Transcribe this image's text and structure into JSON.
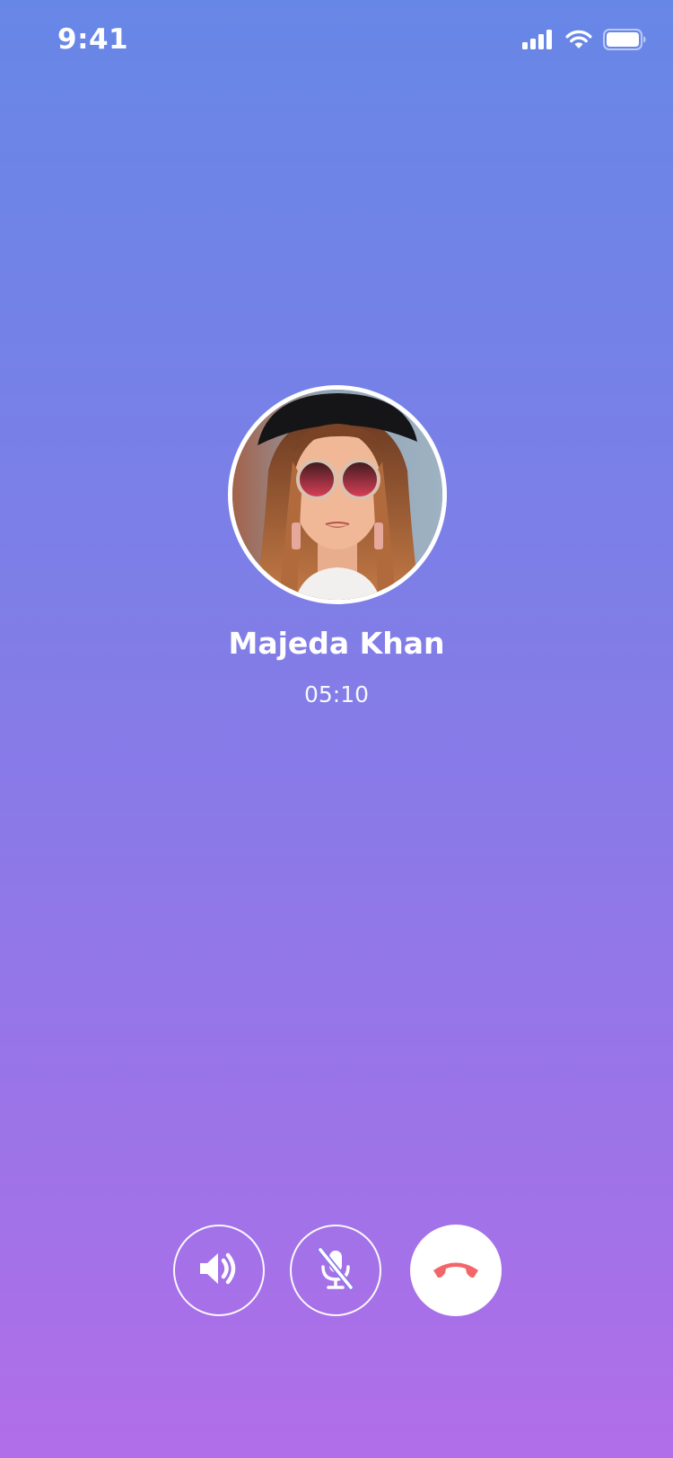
{
  "status_bar": {
    "time": "9:41",
    "icons": [
      "cellular-signal-icon",
      "wifi-icon",
      "battery-icon"
    ]
  },
  "caller": {
    "name": "Majeda Khan",
    "duration": "05:10",
    "avatar": "caller-avatar-photo"
  },
  "controls": [
    {
      "name": "speaker-button",
      "icon": "speaker-icon"
    },
    {
      "name": "mute-button",
      "icon": "microphone-off-icon"
    },
    {
      "name": "end-call-button",
      "icon": "phone-hangup-icon"
    }
  ],
  "colors": {
    "gradient_top": "#6787E7",
    "gradient_bottom": "#B16EE8",
    "end_call_icon": "#F2666A",
    "button_fill": "#FFFFFF"
  }
}
